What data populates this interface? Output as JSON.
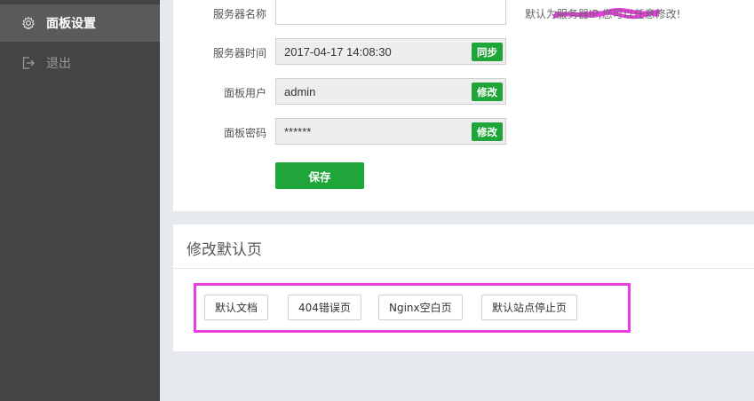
{
  "sidebar": {
    "items": [
      {
        "label": "面板设置",
        "icon": "gear-icon"
      },
      {
        "label": "退出",
        "icon": "logout-icon"
      }
    ]
  },
  "form": {
    "server_name": {
      "label": "服务器名称",
      "value": "",
      "hint": "默认为服务器IP,您可以任意修改!"
    },
    "server_time": {
      "label": "服务器时间",
      "value": "2017-04-17 14:08:30",
      "button": "同步"
    },
    "panel_user": {
      "label": "面板用户",
      "value": "admin",
      "button": "修改"
    },
    "panel_password": {
      "label": "面板密码",
      "value": "******",
      "button": "修改"
    },
    "save_label": "保存"
  },
  "default_pages": {
    "title": "修改默认页",
    "buttons": [
      "默认文档",
      "404错误页",
      "Nginx空白页",
      "默认站点停止页"
    ]
  },
  "colors": {
    "sidebar_bg": "#444444",
    "accent_green": "#20a53a",
    "highlight_magenta": "#e83de0"
  }
}
